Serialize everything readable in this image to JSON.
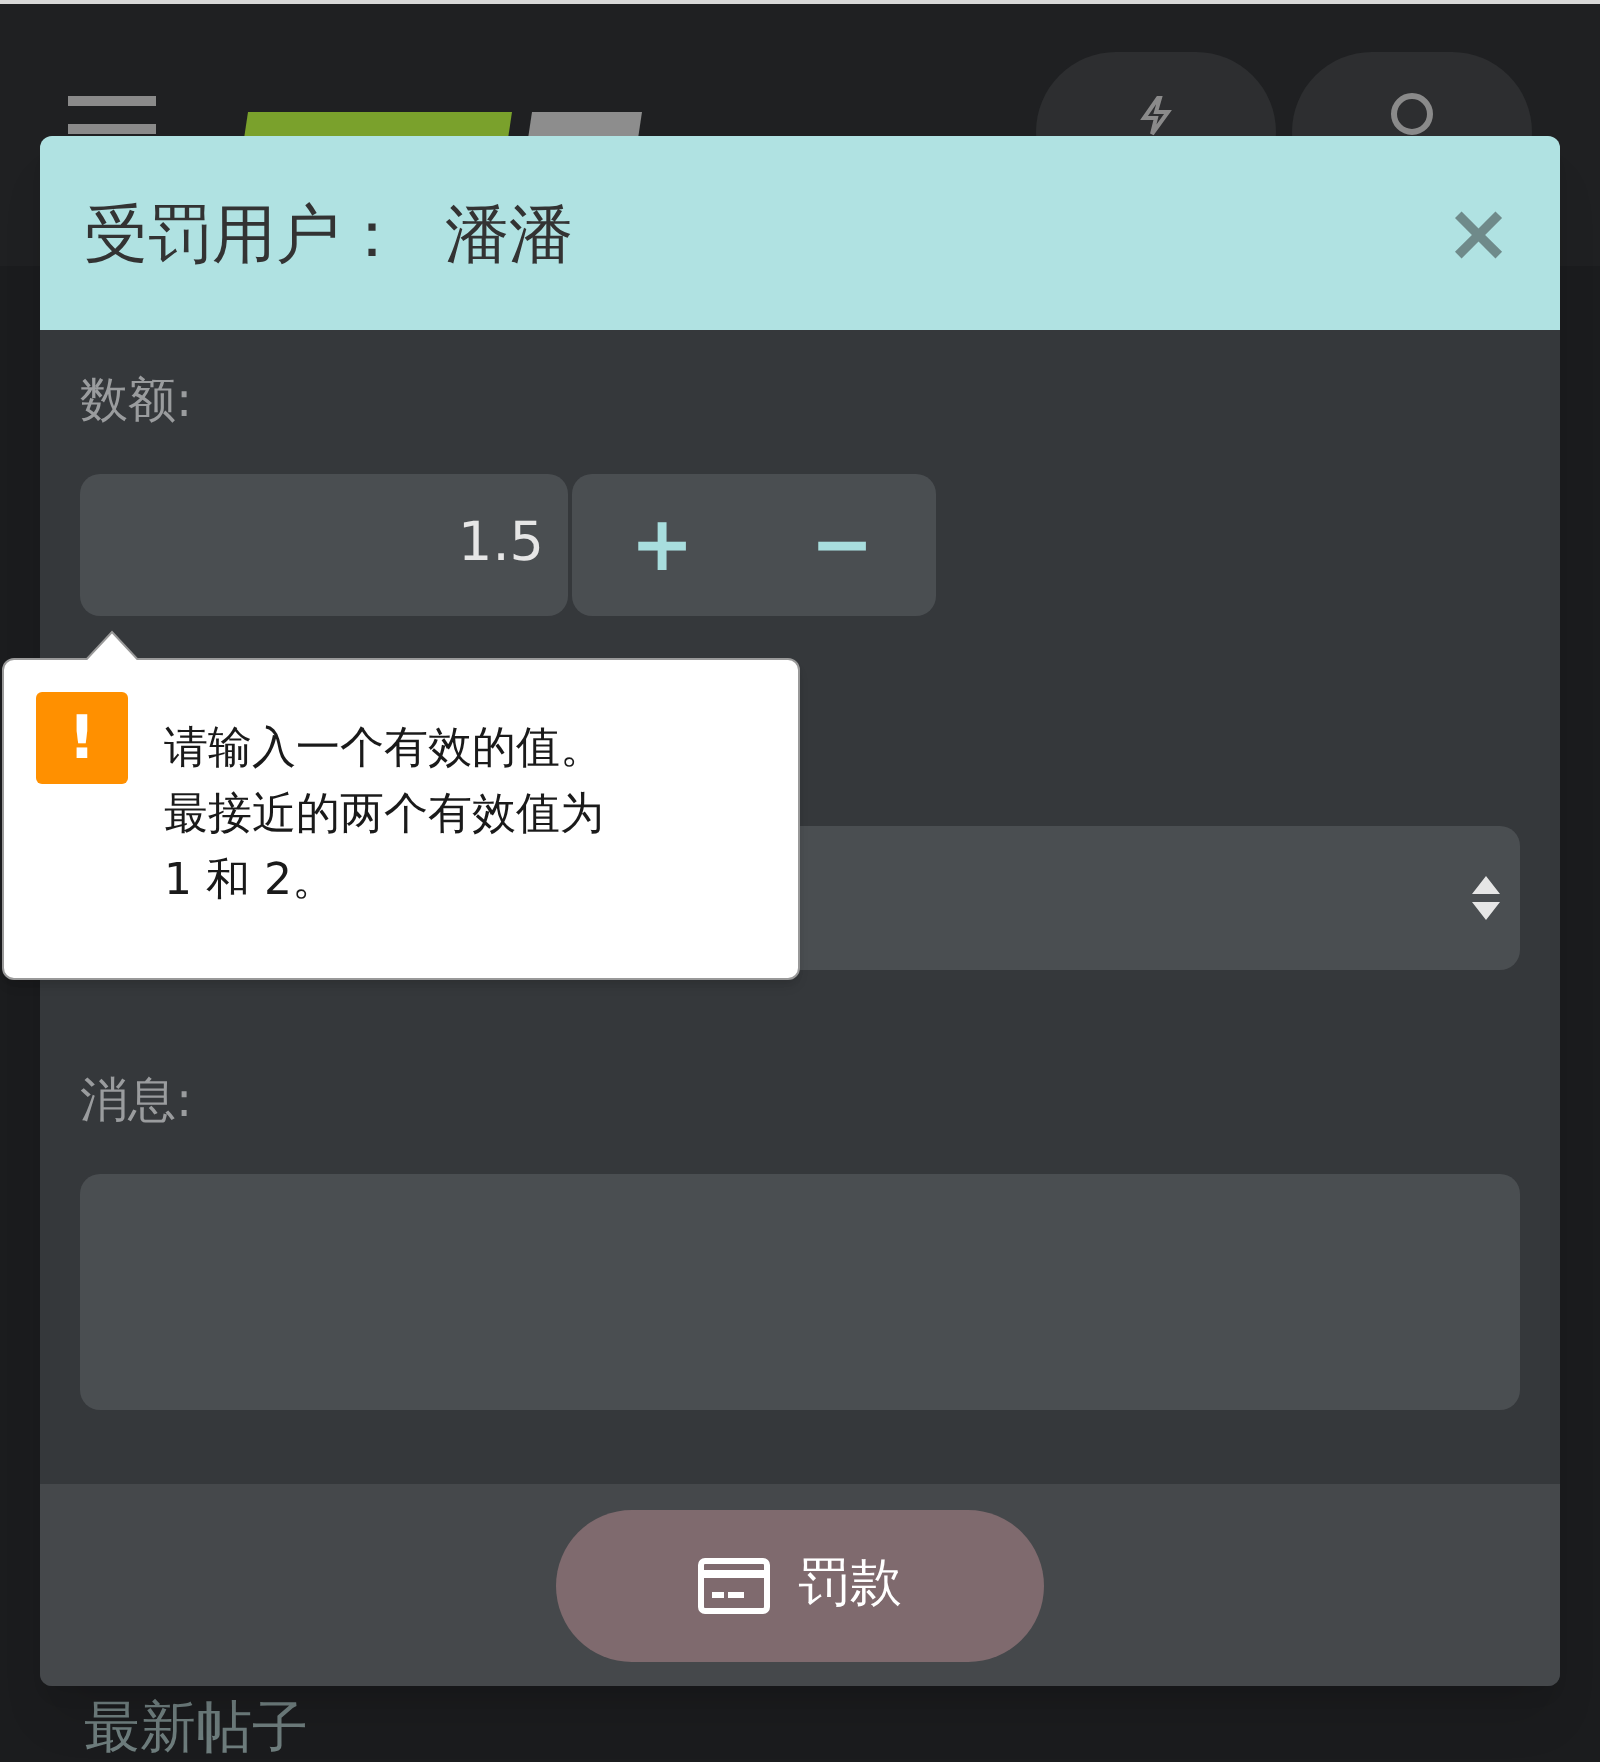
{
  "modal": {
    "title": "受罚用户：",
    "user": "潘潘",
    "close": "×",
    "amount": {
      "label": "数额:",
      "value": "1.5",
      "increment": "+",
      "decrement": "−"
    },
    "validation": {
      "lines": [
        "请输入一个有效的值。",
        "最接近的两个有效值为",
        "1 和 2。"
      ],
      "icon": "!"
    },
    "message": {
      "label": "消息:"
    },
    "submit": {
      "label": "罚款"
    }
  },
  "page": {
    "section_title": "最新帖子"
  }
}
